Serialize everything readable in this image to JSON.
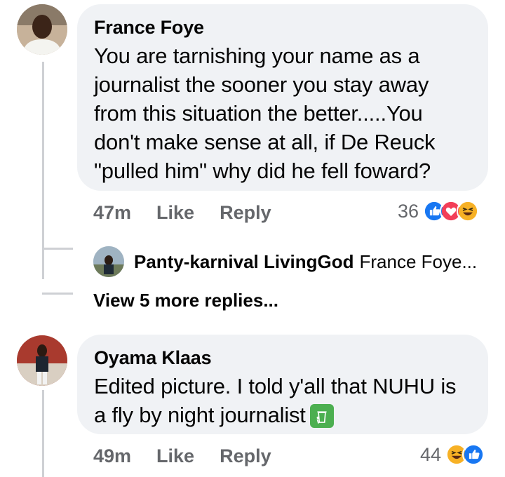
{
  "comments": [
    {
      "author": "France Foye",
      "text": "You are tarnishing your name as a journalist the sooner you stay away from this situation the better.....You don't make sense at all, if De Reuck \"pulled him\" why did he fell foward?",
      "time": "47m",
      "like_label": "Like",
      "reply_label": "Reply",
      "reaction_count": "36",
      "reaction_icons": [
        "like-icon",
        "love-icon",
        "haha-icon"
      ],
      "colors": {
        "like": "#1877f2",
        "love": "#f33e58",
        "haha": "#f7b125"
      }
    },
    {
      "author": "Oyama Klaas",
      "text": "Edited picture. I told y'all that NUHU is a fly by night journalist",
      "emoji": "recycle-bin-emoji",
      "time": "49m",
      "like_label": "Like",
      "reply_label": "Reply",
      "reaction_count": "44",
      "reaction_icons": [
        "haha-icon",
        "like-icon"
      ]
    }
  ],
  "reply_preview": {
    "author": "Panty-karnival LivingGod",
    "snippet": "France Foye..."
  },
  "view_more_label": "View 5 more replies..."
}
